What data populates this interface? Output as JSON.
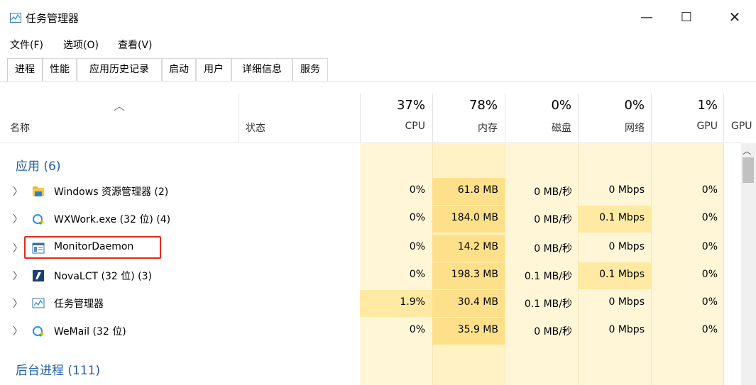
{
  "window": {
    "title": "任务管理器",
    "minimize": "—",
    "maximize": "☐",
    "close": "✕"
  },
  "menu": [
    "文件(F)",
    "选项(O)",
    "查看(V)"
  ],
  "tabs": [
    "进程",
    "性能",
    "应用历史记录",
    "启动",
    "用户",
    "详细信息",
    "服务"
  ],
  "active_tab": "进程",
  "header": {
    "name": "名称",
    "status": "状态",
    "cpu_pct": "37%",
    "cpu": "CPU",
    "mem_pct": "78%",
    "mem": "内存",
    "disk_pct": "0%",
    "disk": "磁盘",
    "net_pct": "0%",
    "net": "网络",
    "gpu_pct": "1%",
    "gpu": "GPU",
    "gpu_engine": "GPU"
  },
  "groups": {
    "apps": "应用 (6)",
    "background": "后台进程 (111)"
  },
  "rows": [
    {
      "name": "Windows 资源管理器 (2)",
      "cpu": "0%",
      "mem": "61.8 MB",
      "disk": "0 MB/秒",
      "net": "0 Mbps",
      "gpu": "0%",
      "icon": "folder-icon"
    },
    {
      "name": "WXWork.exe (32 位) (4)",
      "cpu": "0%",
      "mem": "184.0 MB",
      "disk": "0 MB/秒",
      "net": "0.1 Mbps",
      "gpu": "0%",
      "icon": "wxwork-icon"
    },
    {
      "name": "MonitorDaemon",
      "cpu": "0%",
      "mem": "14.2 MB",
      "disk": "0 MB/秒",
      "net": "0 Mbps",
      "gpu": "0%",
      "icon": "window-app-icon"
    },
    {
      "name": "NovaLCT (32 位) (3)",
      "cpu": "0%",
      "mem": "198.3 MB",
      "disk": "0.1 MB/秒",
      "net": "0.1 Mbps",
      "gpu": "0%",
      "icon": "novalct-icon"
    },
    {
      "name": "任务管理器",
      "cpu": "1.9%",
      "mem": "30.4 MB",
      "disk": "0.1 MB/秒",
      "net": "0 Mbps",
      "gpu": "0%",
      "icon": "task-manager-icon"
    },
    {
      "name": "WeMail (32 位)",
      "cpu": "0%",
      "mem": "35.9 MB",
      "disk": "0 MB/秒",
      "net": "0 Mbps",
      "gpu": "0%",
      "icon": "wemail-icon"
    }
  ],
  "colors": {
    "group_text": "#1f5fa8",
    "highlight_box": "#e5281b",
    "cell_bg": "#fff6d8"
  }
}
